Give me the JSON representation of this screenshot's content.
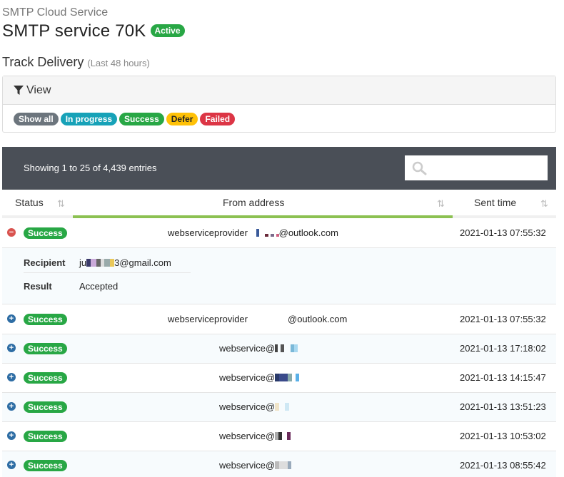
{
  "header": {
    "breadcrumb": "SMTP Cloud Service",
    "title": "SMTP service 70K",
    "status_badge": "Active"
  },
  "section": {
    "title": "Track Delivery",
    "subtitle": "(Last 48 hours)"
  },
  "view_panel": {
    "title": "View",
    "filters": [
      "Show all",
      "In progress",
      "Success",
      "Defer",
      "Failed"
    ]
  },
  "table": {
    "info": "Showing 1 to 25 of 4,439 entries",
    "search": {
      "placeholder": "",
      "value": ""
    },
    "columns": [
      "Status",
      "From address",
      "Sent time"
    ],
    "rows": [
      {
        "status": "Success",
        "from_prefix": "webserviceprovider",
        "from_suffix": "@outlook.com",
        "sent": "2021-01-13 07:55:32",
        "expanded": true
      },
      {
        "status": "Success",
        "from_prefix": "webserviceprovider",
        "from_suffix": "@outlook.com",
        "sent": "2021-01-13 07:55:32",
        "expanded": false
      },
      {
        "status": "Success",
        "from_prefix": "webservice@",
        "from_suffix": "",
        "sent": "2021-01-13 17:18:02",
        "expanded": false
      },
      {
        "status": "Success",
        "from_prefix": "webservice@",
        "from_suffix": "",
        "sent": "2021-01-13 14:15:47",
        "expanded": false
      },
      {
        "status": "Success",
        "from_prefix": "webservice@",
        "from_suffix": "",
        "sent": "2021-01-13 13:51:23",
        "expanded": false
      },
      {
        "status": "Success",
        "from_prefix": "webservice@",
        "from_suffix": "",
        "sent": "2021-01-13 10:53:02",
        "expanded": false
      },
      {
        "status": "Success",
        "from_prefix": "webservice@",
        "from_suffix": "",
        "sent": "2021-01-13 08:55:42",
        "expanded": false
      }
    ],
    "detail": {
      "recipient_label": "Recipient",
      "recipient_prefix": "ju",
      "recipient_suffix": "3@gmail.com",
      "result_label": "Result",
      "result_value": "Accepted"
    }
  },
  "icons": {
    "filter": "filter-icon",
    "search": "search-icon",
    "sort": "sort-icon",
    "expand": "plus-circle-icon",
    "collapse": "minus-circle-icon"
  },
  "colors": {
    "success": "#28a745",
    "info": "#17a2b8",
    "warning": "#ffc107",
    "danger": "#dc3545",
    "secondary": "#6c757d",
    "toolbar": "#4a4f57",
    "active_column": "#8cc152"
  }
}
